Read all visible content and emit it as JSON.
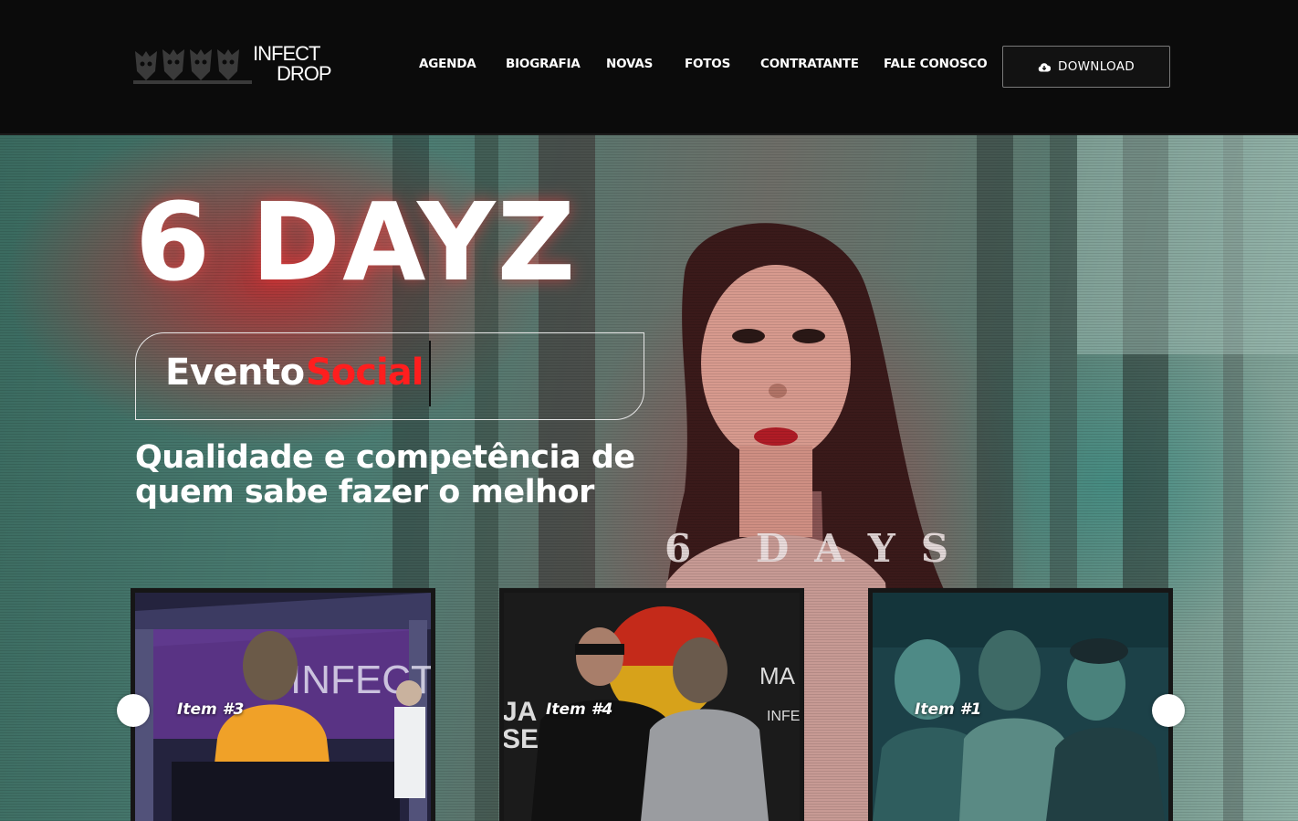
{
  "brand": {
    "name_line1": "INFECT",
    "name_line2": "DROP"
  },
  "nav": {
    "items": [
      "AGENDA",
      "BIOGRAFIA",
      "NOVAS",
      "FOTOS",
      "CONTRATANTE",
      "FALE CONOSCO"
    ],
    "download_label": "DOWNLOAD",
    "download_icon": "cloud-download-icon"
  },
  "hero": {
    "title": "6 DAYZ",
    "typed_word1": "Evento",
    "typed_word2": "Social",
    "subtitle": "Qualidade e competência de quem sabe fazer o melhor",
    "watermark": "6 DAYS",
    "accent_color": "#ff1e1e"
  },
  "carousel": {
    "cards": [
      {
        "label": "Item #3"
      },
      {
        "label": "Item #4"
      },
      {
        "label": "Item #1"
      }
    ],
    "prev_icon": "circle-prev-icon",
    "next_icon": "circle-next-icon"
  }
}
